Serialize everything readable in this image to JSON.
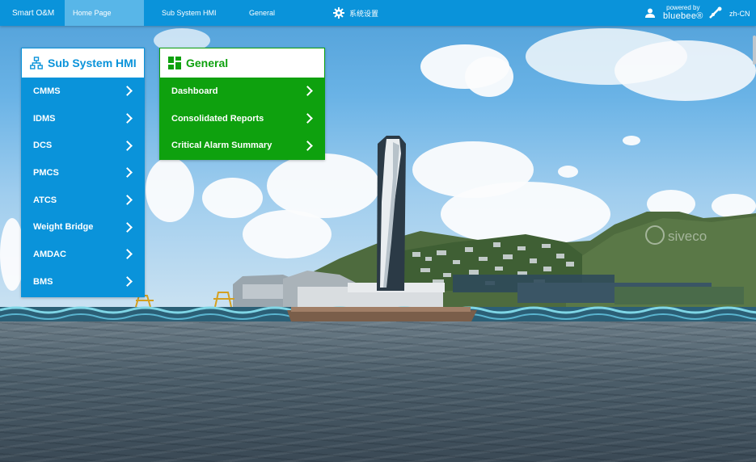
{
  "topbar": {
    "brand": "Smart O&M",
    "nav": [
      {
        "label": "Home Page",
        "active": true
      },
      {
        "label": "Sub System HMI",
        "active": false
      },
      {
        "label": "General",
        "active": false
      }
    ],
    "settings_label": "系统设置",
    "settings_icon": "gear-icon",
    "user_icon": "user-icon",
    "powered_small": "powered by",
    "powered_brand": "bluebee®",
    "language": "zh-CN",
    "colors": {
      "bar": "#0a93da",
      "active_tab": "#58b6e8"
    }
  },
  "subsystem_panel": {
    "title": "Sub System HMI",
    "icon": "sitemap-icon",
    "color": "#0a93da",
    "items": [
      "CMMS",
      "IDMS",
      "DCS",
      "PMCS",
      "ATCS",
      "Weight Bridge",
      "AMDAC",
      "BMS"
    ]
  },
  "general_panel": {
    "title": "General",
    "icon": "grid-icon",
    "color": "#0ea10e",
    "items": [
      "Dashboard",
      "Consolidated Reports",
      "Critical Alarm Summary"
    ]
  },
  "scene": {
    "watermark": "siveco"
  }
}
